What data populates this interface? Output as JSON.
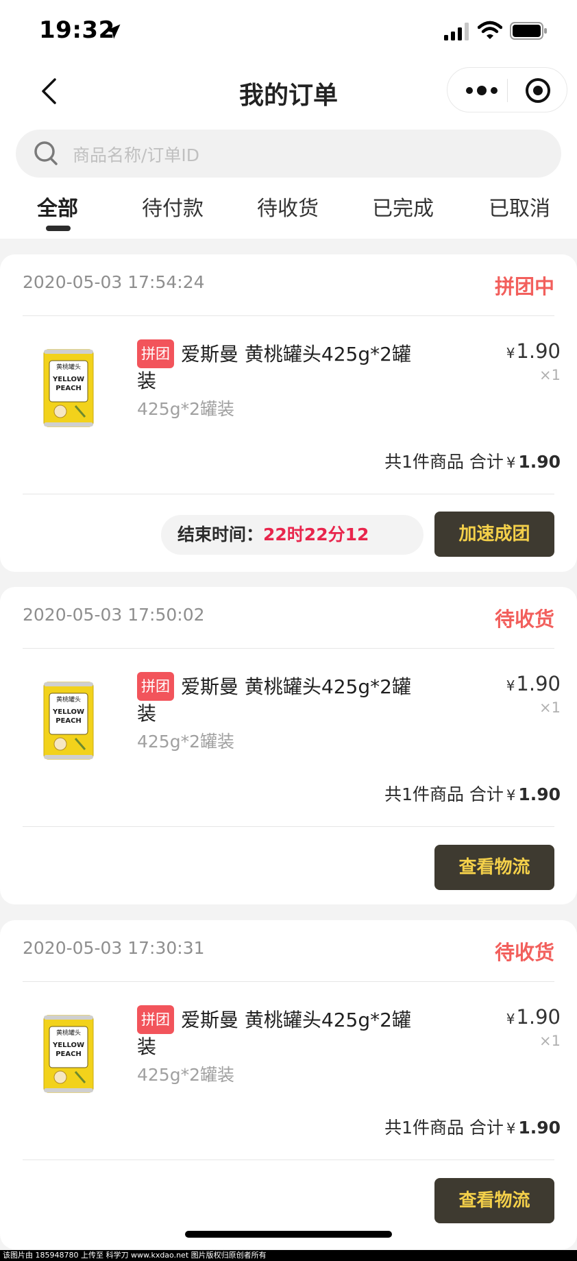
{
  "status_bar": {
    "time": "19:32"
  },
  "nav": {
    "title": "我的订单"
  },
  "search": {
    "placeholder": "商品名称/订单ID"
  },
  "tabs": [
    {
      "label": "全部",
      "active": true
    },
    {
      "label": "待付款"
    },
    {
      "label": "待收货"
    },
    {
      "label": "已完成"
    },
    {
      "label": "已取消"
    }
  ],
  "orders": [
    {
      "datetime": "2020-05-03 17:54:24",
      "status": "拼团中",
      "product": {
        "tag": "拼团",
        "name": "爱斯曼 黄桃罐头425g*2罐装",
        "spec": "425g*2罐装",
        "price": "1.90",
        "qty": "×1"
      },
      "summary": {
        "count_text": "共1件商品",
        "total_label": "合计",
        "total": "1.90"
      },
      "countdown": {
        "label": "结束时间：",
        "value": "22时22分12"
      },
      "action": "加速成团"
    },
    {
      "datetime": "2020-05-03 17:50:02",
      "status": "待收货",
      "product": {
        "tag": "拼团",
        "name": "爱斯曼 黄桃罐头425g*2罐装",
        "spec": "425g*2罐装",
        "price": "1.90",
        "qty": "×1"
      },
      "summary": {
        "count_text": "共1件商品",
        "total_label": "合计",
        "total": "1.90"
      },
      "action": "查看物流"
    },
    {
      "datetime": "2020-05-03 17:30:31",
      "status": "待收货",
      "product": {
        "tag": "拼团",
        "name": "爱斯曼 黄桃罐头425g*2罐装",
        "spec": "425g*2罐装",
        "price": "1.90",
        "qty": "×1"
      },
      "summary": {
        "count_text": "共1件商品",
        "total_label": "合计",
        "total": "1.90"
      },
      "action": "查看物流"
    }
  ],
  "currency_symbol": "¥",
  "can_label": {
    "top": "黄桃罐头",
    "line1": "YELLOW",
    "line2": "PEACH"
  },
  "footer_watermark": "该图片由 185948780 上传至 科学刀 www.kxdao.net 图片版权归原创者所有",
  "colors": {
    "accent_red": "#f25f5c",
    "tag_red": "#f2545b",
    "button_bg": "#3e3a30",
    "button_text": "#f4d04a",
    "countdown_red": "#e8254c"
  }
}
